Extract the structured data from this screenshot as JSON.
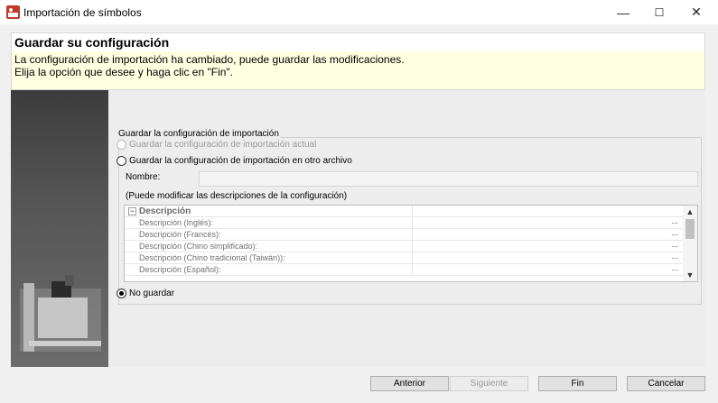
{
  "window": {
    "title": "Importación de símbolos",
    "minimize": "—",
    "maximize": "☐",
    "close": "✕"
  },
  "header": {
    "title": "Guardar su configuración",
    "description": "La configuración de importación ha cambiado, puede guardar las modificaciones.\nElija la opción que desee y haga clic en \"Fin\"."
  },
  "group": {
    "legend": "Guardar la configuración de importación",
    "options": [
      {
        "label": "Guardar la configuración de importación actual",
        "enabled": false,
        "checked": false
      },
      {
        "label": "Guardar la configuración de importación en otro archivo",
        "enabled": true,
        "checked": false
      },
      {
        "label": "No guardar",
        "enabled": true,
        "checked": true
      }
    ],
    "name_label": "Nombre:",
    "name_value": "",
    "hint": "(Puede modificar las descripciones de la configuración)"
  },
  "grid": {
    "category": "Descripción",
    "expand_symbol": "−",
    "rows": [
      {
        "label": "Descripción (Inglés):",
        "value": "",
        "ellipsis": "..."
      },
      {
        "label": "Descripción (Francés):",
        "value": "",
        "ellipsis": "..."
      },
      {
        "label": "Descripción (Chino simplificado):",
        "value": "",
        "ellipsis": "..."
      },
      {
        "label": "Descripción (Chino tradicional (Taiwán)):",
        "value": "",
        "ellipsis": "..."
      },
      {
        "label": "Descripción (Español):",
        "value": "",
        "ellipsis": "..."
      }
    ],
    "scroll_up": "▲",
    "scroll_down": "▼"
  },
  "footer": {
    "back_label": "Anterior",
    "next_label": "Siguiente",
    "finish_label": "Fin",
    "cancel_label": "Cancelar"
  },
  "colors": {
    "header_bg": "#ffffe1",
    "side_panel": "#4a4a4a"
  }
}
